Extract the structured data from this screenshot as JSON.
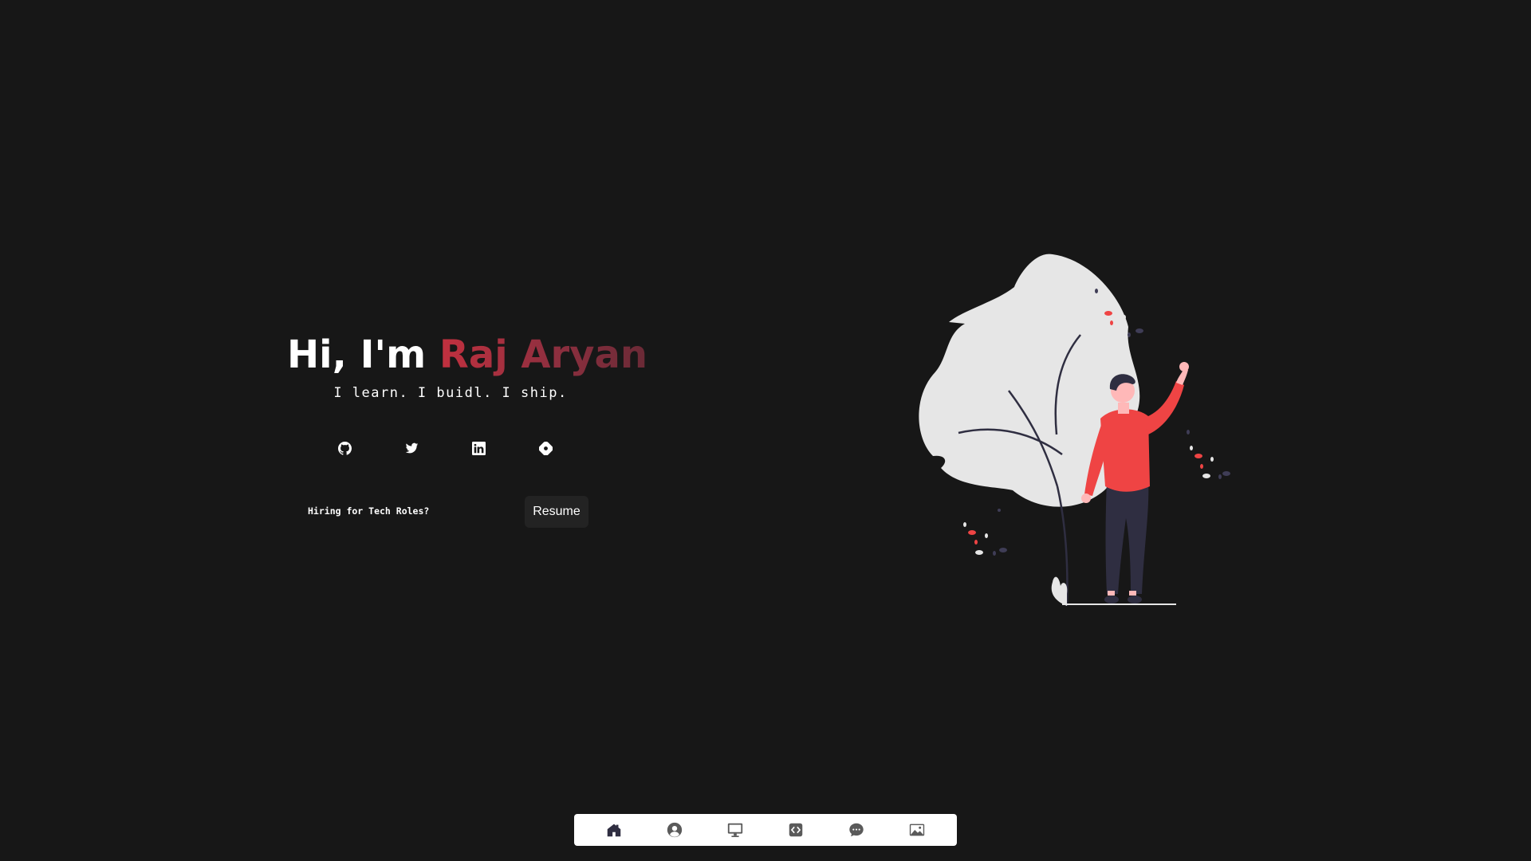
{
  "hero": {
    "greeting": "Hi, I'm ",
    "name": "Raj Aryan",
    "tagline": "I learn. I buidl. I ship."
  },
  "socials": [
    {
      "icon": "github-icon"
    },
    {
      "icon": "twitter-icon"
    },
    {
      "icon": "linkedin-icon"
    },
    {
      "icon": "hashnode-icon"
    }
  ],
  "hire": {
    "prompt": "Hiring for Tech Roles?",
    "button_label": "Resume"
  },
  "navbar": {
    "items": [
      {
        "icon": "home-icon"
      },
      {
        "icon": "user-icon"
      },
      {
        "icon": "monitor-icon"
      },
      {
        "icon": "code-icon"
      },
      {
        "icon": "chat-icon"
      },
      {
        "icon": "image-icon"
      }
    ]
  },
  "colors": {
    "background": "#171717",
    "accent": "#c2303f",
    "person_shirt": "#ef4444",
    "leaf": "#e6e6e6",
    "navbar_bg": "#ffffff",
    "nav_icon": "#4b4b4b",
    "nav_active": "#2f2e41"
  }
}
